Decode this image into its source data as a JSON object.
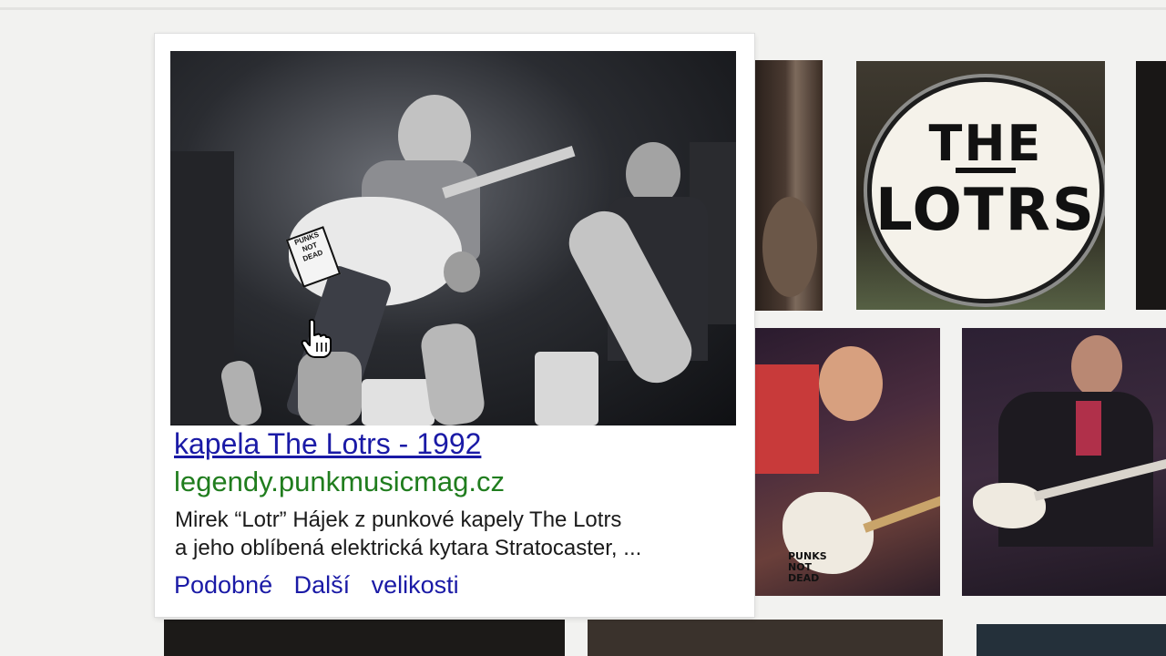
{
  "result_card": {
    "title": "kapela The Lotrs - 1992",
    "source": "legendy.punkmusicmag.cz",
    "description_line1": "Mirek “Lotr” Hájek z punkové kapely The Lotrs",
    "description_line2": "a jeho oblíbená elektrická kytara Stratocaster, ...",
    "actions": {
      "similar": "Podobné",
      "more": "Další",
      "sizes": "velikosti"
    },
    "photo_sticker_text": "PUNKS NOT DEAD"
  },
  "thumbnails": {
    "drum_line1": "THE",
    "drum_line2": "LOTRS",
    "guitar_sticker_text": "PUNKS NOT DEAD"
  },
  "icons": {
    "cursor": "hand-pointer-icon"
  },
  "colors": {
    "link_blue": "#1a1aa6",
    "source_green": "#207d1e",
    "page_bg": "#f2f2f0"
  }
}
